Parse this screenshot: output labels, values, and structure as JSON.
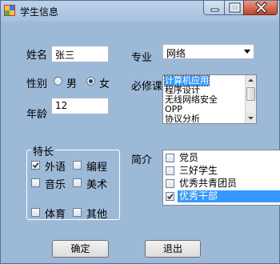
{
  "window": {
    "title": "学生信息"
  },
  "form": {
    "name_label": "姓名",
    "name_value": "张三",
    "gender_label": "性别",
    "gender_options": [
      "男",
      "女"
    ],
    "gender_selected": "女",
    "age_label": "年龄",
    "age_value": "12",
    "major_label": "专业",
    "major_value": "网络",
    "required_label": "必修课",
    "required_courses": [
      "计算机应用",
      "程序设计",
      "无线网络安全",
      "OPP",
      "协议分析"
    ],
    "required_selected": "计算机应用",
    "specialty": {
      "title": "特长",
      "options": [
        {
          "label": "外语",
          "checked": true
        },
        {
          "label": "编程",
          "checked": false
        },
        {
          "label": "音乐",
          "checked": false
        },
        {
          "label": "美术",
          "checked": false
        },
        {
          "label": "体育",
          "checked": false
        },
        {
          "label": "其他",
          "checked": false
        }
      ]
    },
    "intro_label": "简介",
    "intro_items": [
      {
        "label": "党员",
        "checked": false
      },
      {
        "label": "三好学生",
        "checked": false
      },
      {
        "label": "优秀共青团员",
        "checked": false
      },
      {
        "label": "优秀干部",
        "checked": true,
        "selected": true
      }
    ]
  },
  "buttons": {
    "ok": "确定",
    "exit": "退出"
  }
}
